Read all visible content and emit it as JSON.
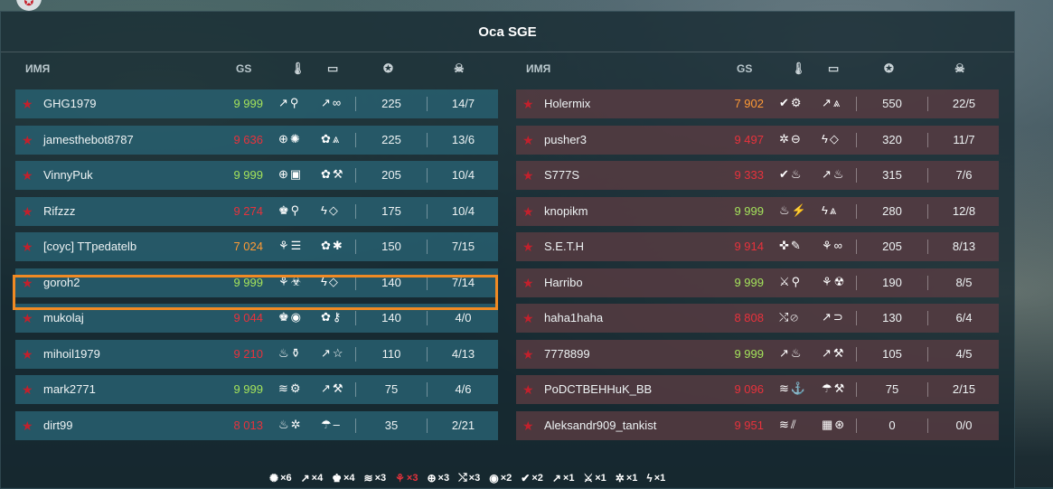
{
  "title": "Оса SGE",
  "headers": {
    "name": "ИМЯ",
    "gs": "GS"
  },
  "icons": {
    "thermo": "🌡",
    "tank": "▭",
    "score": "✪",
    "skull": "☠",
    "star": "★"
  },
  "colors": {
    "accent_orange": "#f08a23",
    "red": "#e8323c",
    "green": "#a4e25b",
    "orange": "#ff9a35"
  },
  "team_a": [
    {
      "name": "GHG1979",
      "gs": "9 999",
      "gs_color": "green",
      "drones": "↗⚲",
      "mods": "↗∞",
      "score": "225",
      "kd": "14/7"
    },
    {
      "name": "jamesthebot8787",
      "gs": "9 636",
      "gs_color": "red",
      "drones": "⊕✺",
      "mods": "✿⩓",
      "score": "225",
      "kd": "13/6"
    },
    {
      "name": "VinnyPuk",
      "gs": "9 999",
      "gs_color": "green",
      "drones": "⊕▣",
      "mods": "✿⚒",
      "score": "205",
      "kd": "10/4"
    },
    {
      "name": "Rifzzz",
      "gs": "9 274",
      "gs_color": "red",
      "drones": "♚⚲",
      "mods": "ϟ◇",
      "score": "175",
      "kd": "10/4"
    },
    {
      "name": "[coyc] TTpedatelb",
      "gs": "7 024",
      "gs_color": "orange",
      "drones": "⚘☰",
      "mods": "✿✱",
      "score": "150",
      "kd": "7/15"
    },
    {
      "name": "goroh2",
      "gs": "9 999",
      "gs_color": "green",
      "drones": "⚘☣",
      "mods": "ϟ◇",
      "score": "140",
      "kd": "7/14"
    },
    {
      "name": "mukolaj",
      "gs": "9 044",
      "gs_color": "red",
      "drones": "♚◉",
      "mods": "✿⚷",
      "score": "140",
      "kd": "4/0"
    },
    {
      "name": "mihoil1979",
      "gs": "9 210",
      "gs_color": "red",
      "drones": "♨⚱",
      "mods": "↗☆",
      "score": "110",
      "kd": "4/13"
    },
    {
      "name": "mark2771",
      "gs": "9 999",
      "gs_color": "green",
      "drones": "≋⚙",
      "mods": "↗⚒",
      "score": "75",
      "kd": "4/6"
    },
    {
      "name": "dirt99",
      "gs": "8 013",
      "gs_color": "red",
      "drones": "♨✲",
      "mods": "☂–",
      "score": "35",
      "kd": "2/21"
    }
  ],
  "team_b": [
    {
      "name": "Holermix",
      "gs": "7 902",
      "gs_color": "orange",
      "drones": "✔⚙",
      "mods": "↗⩓",
      "score": "550",
      "kd": "22/5"
    },
    {
      "name": "pusher3",
      "gs": "9 497",
      "gs_color": "red",
      "drones": "✲⊖",
      "mods": "ϟ◇",
      "score": "320",
      "kd": "11/7"
    },
    {
      "name": "S777S",
      "gs": "9 333",
      "gs_color": "red",
      "drones": "✔♨",
      "mods": "↗♨",
      "score": "315",
      "kd": "7/6"
    },
    {
      "name": "knopikm",
      "gs": "9 999",
      "gs_color": "green",
      "drones": "♨⚡",
      "mods": "ϟ⩓",
      "score": "280",
      "kd": "12/8"
    },
    {
      "name": "S.E.T.H",
      "gs": "9 914",
      "gs_color": "red",
      "drones": "✜✎",
      "mods": "⚘∞",
      "score": "205",
      "kd": "8/13"
    },
    {
      "name": "Harribo",
      "gs": "9 999",
      "gs_color": "green",
      "drones": "⚔⚲",
      "mods": "⚘☢",
      "score": "190",
      "kd": "8/5"
    },
    {
      "name": "haha1haha",
      "gs": "8 808",
      "gs_color": "red",
      "drones": "⤭⊘",
      "mods": "↗⊃",
      "score": "130",
      "kd": "6/4"
    },
    {
      "name": "7778899",
      "gs": "9 999",
      "gs_color": "green",
      "drones": "↗♨",
      "mods": "↗⚒",
      "score": "105",
      "kd": "4/5"
    },
    {
      "name": "PoDCTBEHHuK_BB",
      "gs": "9 096",
      "gs_color": "red",
      "drones": "≋⚓",
      "mods": "☂⚒",
      "score": "75",
      "kd": "2/15"
    },
    {
      "name": "Aleksandr909_tankist",
      "gs": "9 951",
      "gs_color": "red",
      "drones": "≋⫽",
      "mods": "▦⊛",
      "score": "0",
      "kd": "0/0"
    }
  ],
  "supplies": [
    {
      "glyph": "✺",
      "count": "×6",
      "red": false
    },
    {
      "glyph": "↗",
      "count": "×4",
      "red": false
    },
    {
      "glyph": "♚",
      "count": "×4",
      "red": false
    },
    {
      "glyph": "≋",
      "count": "×3",
      "red": false
    },
    {
      "glyph": "⚘",
      "count": "×3",
      "red": true
    },
    {
      "glyph": "⊕",
      "count": "×3",
      "red": false
    },
    {
      "glyph": "⤭",
      "count": "×3",
      "red": false
    },
    {
      "glyph": "◉",
      "count": "×2",
      "red": false
    },
    {
      "glyph": "✔",
      "count": "×2",
      "red": false
    },
    {
      "glyph": "↗",
      "count": "×1",
      "red": false
    },
    {
      "glyph": "⚔",
      "count": "×1",
      "red": false
    },
    {
      "glyph": "✲",
      "count": "×1",
      "red": false
    },
    {
      "glyph": "ϟ",
      "count": "×1",
      "red": false
    }
  ]
}
